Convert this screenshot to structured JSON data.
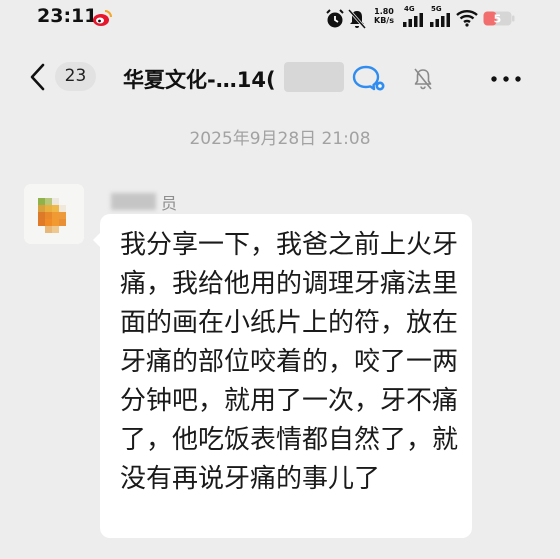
{
  "status_bar": {
    "time": "23:11",
    "net_speed_value": "1.80",
    "net_speed_unit": "KB/s",
    "signal_1_label": "4G",
    "signal_2_label": "5G",
    "battery_level": "5"
  },
  "header": {
    "unread_count": "23",
    "title": "华夏文化-…14("
  },
  "chat": {
    "timestamp": "2025年9月28日 21:08",
    "sender_name": "员",
    "message": "我分享一下，我爸之前上火牙痛，我给他用的调理牙痛法里面的画在小纸片上的符，放在牙痛的部位咬着的，咬了一两分钟吧，就用了一次，牙不痛了，他吃饭表情都自然了，就没有再说牙痛的事儿了"
  },
  "colors": {
    "background": "#ededed",
    "bubble": "#ffffff",
    "accent_blue": "#2f8cf0",
    "battery_red": "#f26d6d"
  }
}
